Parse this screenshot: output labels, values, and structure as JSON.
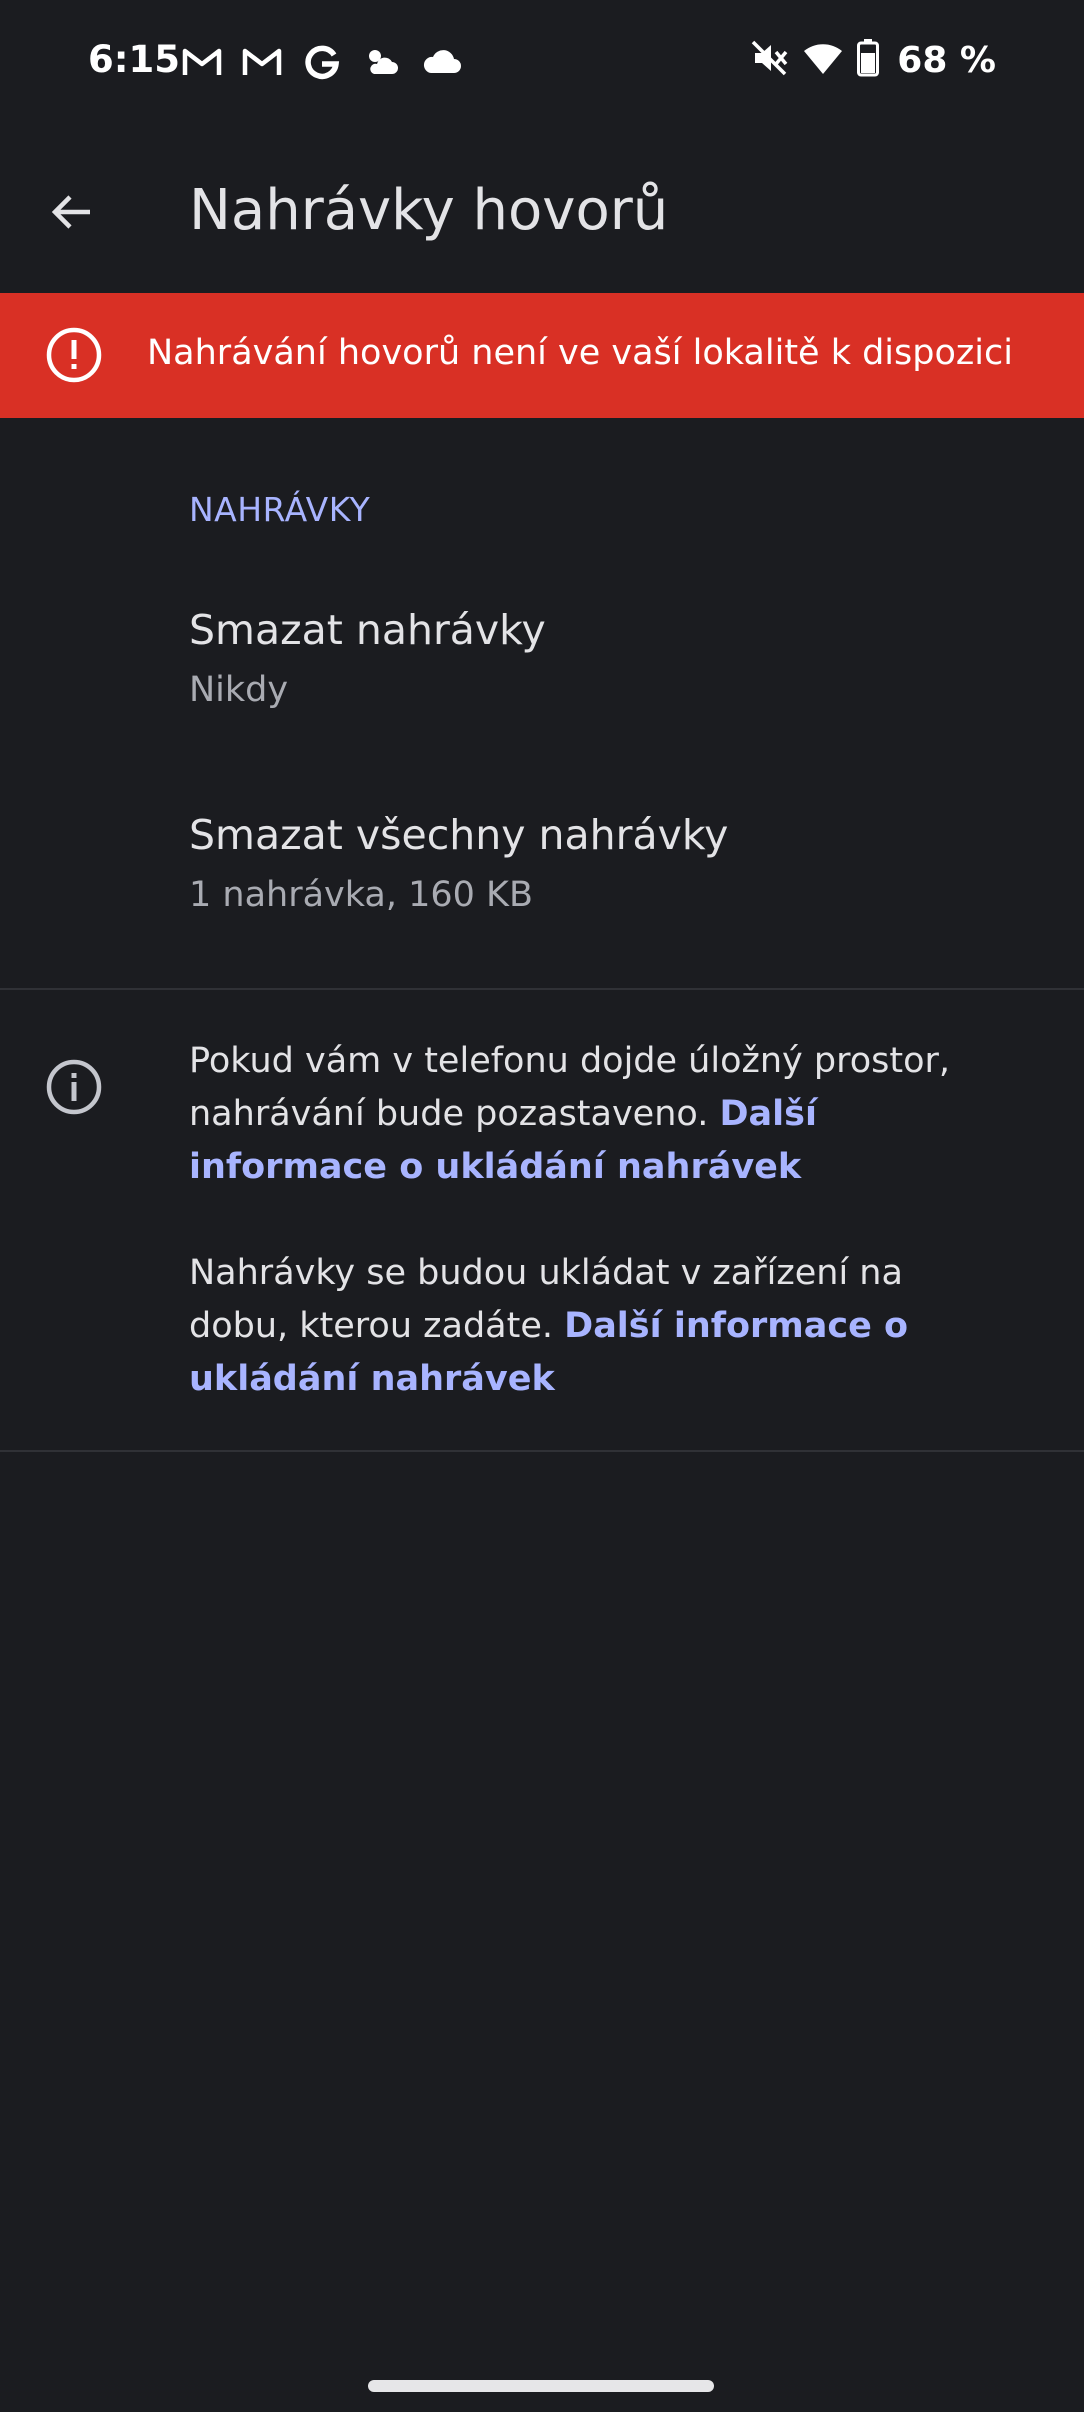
{
  "status_bar": {
    "time": "6:15",
    "left_icons": [
      "gmail-icon",
      "gmail-icon",
      "google-icon",
      "weather-partly-cloudy-icon",
      "cloud-icon"
    ],
    "right_icons": [
      "mute-vibrate-icon",
      "wifi-icon",
      "battery-icon"
    ],
    "battery": "68 %"
  },
  "app_bar": {
    "back_icon": "arrow-back-icon",
    "title": "Nahrávky hovorů"
  },
  "banner": {
    "icon": "error-icon",
    "text": "Nahrávání hovorů není ve vaší lokalitě k dispozici",
    "color": "#d93025"
  },
  "recordings_section": {
    "header": "NAHRÁVKY",
    "items": [
      {
        "title": "Smazat nahrávky",
        "summary": "Nikdy"
      },
      {
        "title": "Smazat všechny nahrávky",
        "summary": "1 nahrávka, 160 KB"
      }
    ]
  },
  "info": {
    "icon": "info-icon",
    "para1_text": "Pokud vám v telefonu dojde úložný prostor, nahrávání bude pozastaveno. ",
    "para1_link": "Další informace o ukládání nahrávek",
    "para2_text": "Nahrávky se budou ukládat v zařízení na dobu, kterou zadáte. ",
    "para2_link": "Další informace o ukládání nahrávek"
  },
  "colors": {
    "background": "#1b1c20",
    "accent": "#a8b4ff",
    "error": "#d93025"
  }
}
